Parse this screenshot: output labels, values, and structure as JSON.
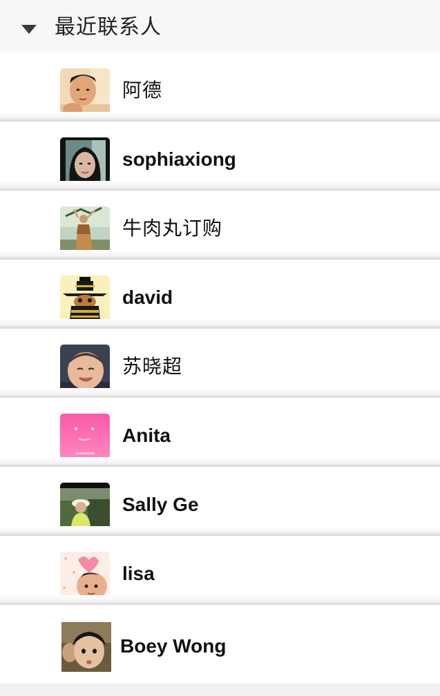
{
  "group": {
    "title": "最近联系人",
    "expanded": true
  },
  "contacts": [
    {
      "name": "阿德",
      "avatar": "man-portrait-avatar"
    },
    {
      "name": "sophiaxiong",
      "avatar": "woman-portrait-avatar"
    },
    {
      "name": "牛肉丸订购",
      "avatar": "woman-in-field-avatar"
    },
    {
      "name": "david",
      "avatar": "cartoon-character-avatar"
    },
    {
      "name": "苏晓超",
      "avatar": "baby-face-avatar"
    },
    {
      "name": "Anita",
      "avatar": "pink-smiley-avatar"
    },
    {
      "name": "Sally Ge",
      "avatar": "woman-outdoors-avatar"
    },
    {
      "name": "lisa",
      "avatar": "baby-with-heart-avatar"
    },
    {
      "name": "Boey Wong",
      "avatar": "child-portrait-avatar"
    }
  ]
}
